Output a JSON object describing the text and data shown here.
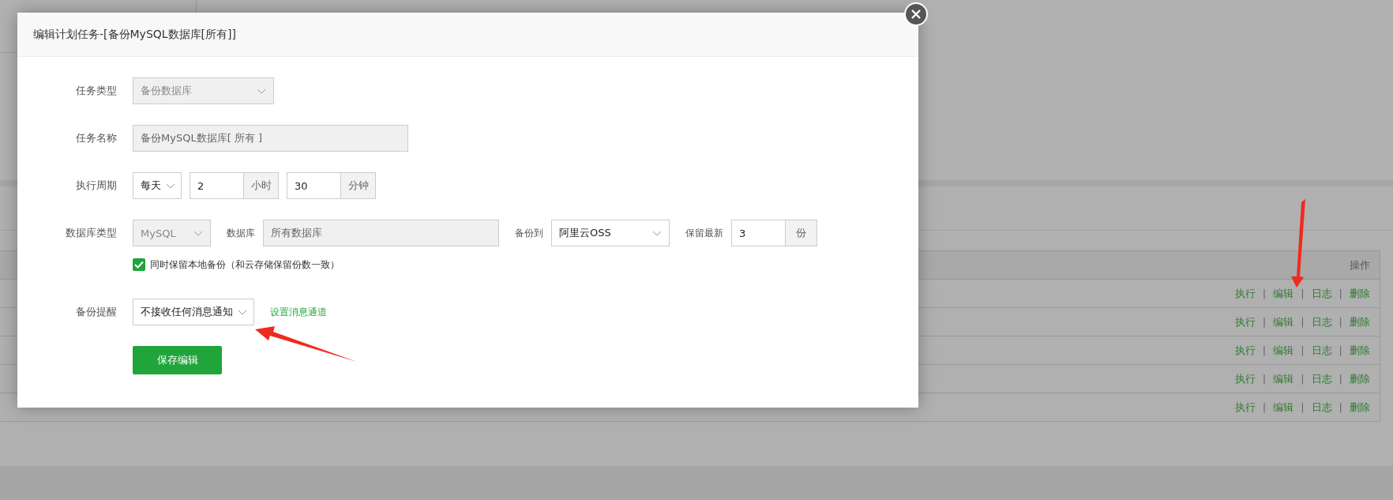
{
  "dialog": {
    "title": "编辑计划任务-[备份MySQL数据库[所有]]",
    "rows": [
      {
        "label": "任务类型",
        "controls": [
          {
            "kind": "select",
            "value": "备份数据库",
            "disabled": true
          }
        ]
      },
      {
        "label": "任务名称",
        "controls": [
          {
            "kind": "input",
            "value": "备份MySQL数据库[ 所有 ]",
            "disabled": true
          }
        ]
      },
      {
        "label": "执行周期",
        "controls": [
          {
            "kind": "select",
            "value": "每天",
            "disabled": false
          },
          {
            "kind": "input",
            "value": "2",
            "addon": "小时",
            "disabled": false
          },
          {
            "kind": "input",
            "value": "30",
            "addon": "分钟",
            "disabled": false
          }
        ]
      },
      {
        "label": "数据库类型",
        "controls": [
          {
            "kind": "select",
            "value": "MySQL",
            "disabled": true
          },
          {
            "kind": "label",
            "value": "数据库"
          },
          {
            "kind": "input",
            "value": "所有数据库",
            "disabled": true
          },
          {
            "kind": "label",
            "value": "备份到"
          },
          {
            "kind": "select",
            "value": "阿里云OSS",
            "disabled": false
          },
          {
            "kind": "label",
            "value": "保留最新"
          },
          {
            "kind": "input",
            "value": "3",
            "addon": "份",
            "disabled": false
          }
        ]
      },
      {
        "controls": [
          {
            "kind": "checkbox",
            "value": "同时保留本地备份（和云存储保留份数一致）",
            "checked": true
          }
        ]
      },
      {
        "label": "备份提醒",
        "controls": [
          {
            "kind": "select",
            "value": "不接收任何消息通知",
            "disabled": false
          },
          {
            "kind": "link",
            "value": "设置消息通道"
          }
        ]
      }
    ],
    "save_button": "保存编辑"
  },
  "table": {
    "columns": [
      "操作"
    ],
    "action_separator": "|",
    "rows": [
      {
        "actions": [
          "执行",
          "编辑",
          "日志",
          "删除"
        ]
      },
      {
        "actions": [
          "执行",
          "编辑",
          "日志",
          "删除"
        ]
      },
      {
        "actions": [
          "执行",
          "编辑",
          "日志",
          "删除"
        ]
      },
      {
        "actions": [
          "执行",
          "编辑",
          "日志",
          "删除"
        ]
      },
      {
        "actions": [
          "执行",
          "编辑",
          "日志",
          "删除"
        ]
      }
    ]
  }
}
